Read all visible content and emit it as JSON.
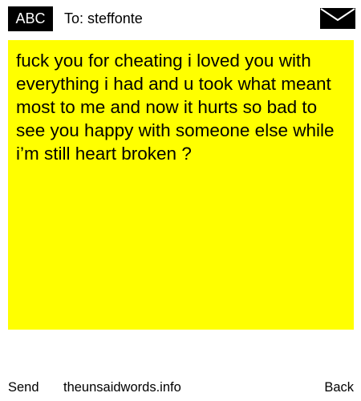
{
  "header": {
    "badge_label": "ABC",
    "recipient": "To: steffonte",
    "envelope_icon": "envelope-icon"
  },
  "message": {
    "text": "fuck you for cheating i loved you with everything i had and u took what meant most to me and now it hurts so bad to see you happy with someone else while i’m still heart broken ?",
    "background_color": "#ffff00"
  },
  "footer": {
    "send_label": "Send",
    "site_label": "theunsaidwords.info",
    "back_label": "Back"
  }
}
